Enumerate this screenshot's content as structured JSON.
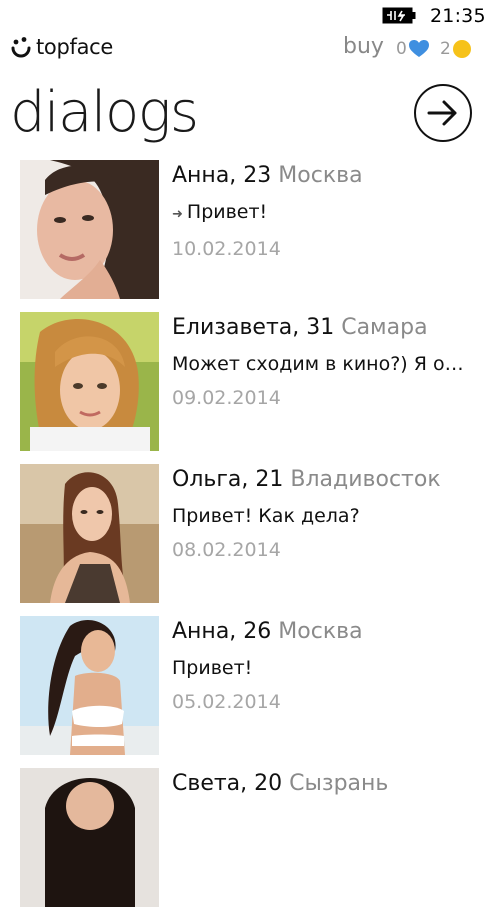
{
  "status": {
    "time": "21:35"
  },
  "brand": {
    "name": "topface"
  },
  "header": {
    "buy_label": "buy",
    "likes_count": "0",
    "coins_count": "2"
  },
  "page": {
    "title": "dialogs"
  },
  "dialogs": [
    {
      "name": "Анна, 23",
      "city": "Москва",
      "message": "Привет!",
      "reply": true,
      "date": "10.02.2014"
    },
    {
      "name": "Елизавета, 31",
      "city": "Самара",
      "message": "Может сходим в кино?) Я оч...",
      "reply": false,
      "date": "09.02.2014"
    },
    {
      "name": "Ольга, 21",
      "city": "Владивосток",
      "message": "Привет! Как дела?",
      "reply": false,
      "date": "08.02.2014"
    },
    {
      "name": "Анна, 26",
      "city": "Москва",
      "message": "Привет!",
      "reply": false,
      "date": "05.02.2014"
    },
    {
      "name": "Света, 20",
      "city": "Сызрань",
      "message": "",
      "reply": false,
      "date": ""
    }
  ],
  "colors": {
    "heart": "#3f8fe0",
    "coin": "#f6c21a",
    "muted": "#8a8a8a"
  }
}
